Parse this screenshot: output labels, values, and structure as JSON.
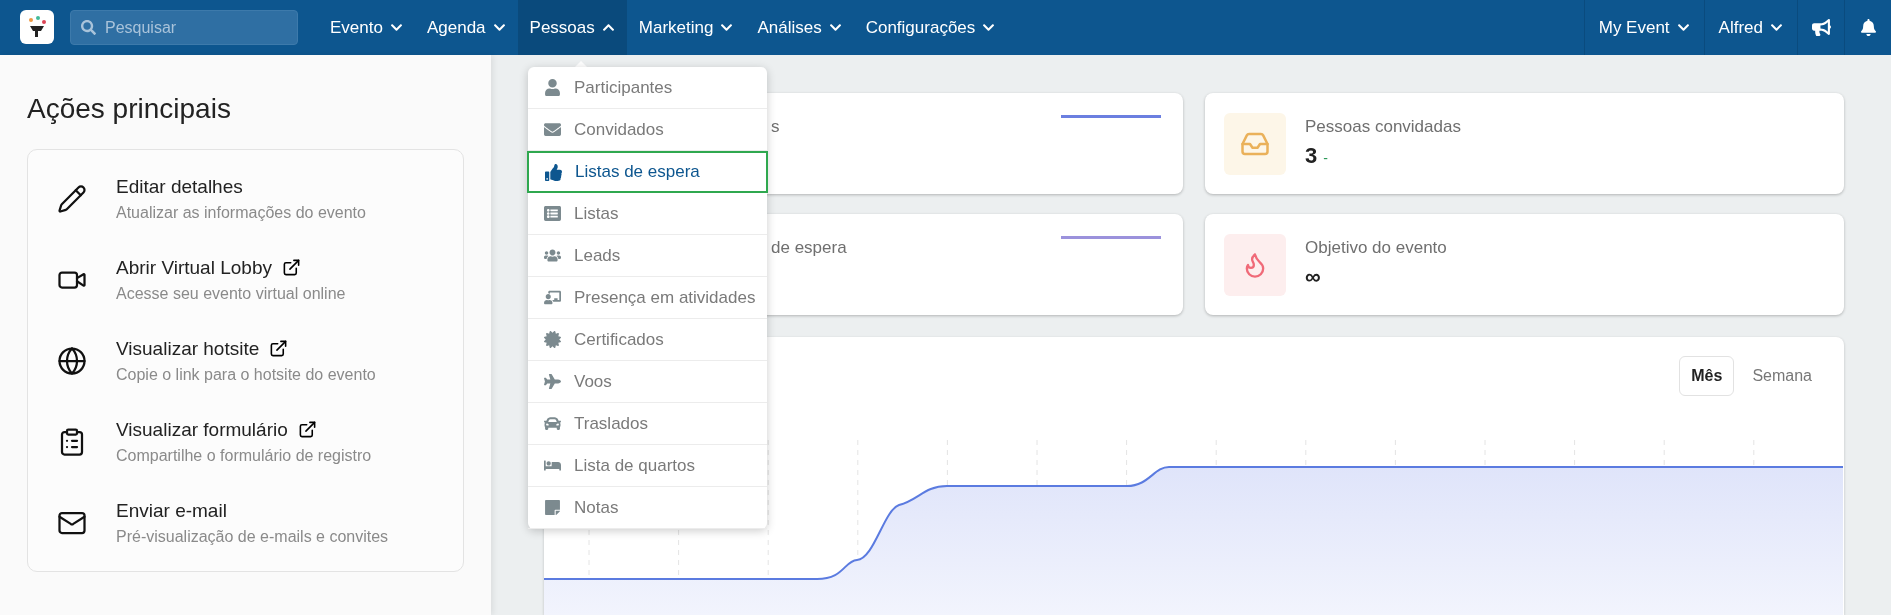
{
  "nav": {
    "search": {
      "placeholder": "Pesquisar"
    },
    "menus": [
      {
        "label": "Evento",
        "expanded": false
      },
      {
        "label": "Agenda",
        "expanded": false
      },
      {
        "label": "Pessoas",
        "expanded": true
      },
      {
        "label": "Marketing",
        "expanded": false
      },
      {
        "label": "Análises",
        "expanded": false
      },
      {
        "label": "Configurações",
        "expanded": false
      }
    ],
    "right_menus": [
      {
        "label": "My Event",
        "expanded": false
      },
      {
        "label": "Alfred",
        "expanded": false
      }
    ]
  },
  "sidebar": {
    "title": "Ações principais",
    "actions": [
      {
        "title": "Editar detalhes",
        "subtitle": "Atualizar as informações do evento",
        "external": false
      },
      {
        "title": "Abrir Virtual Lobby",
        "subtitle": "Acesse seu evento virtual online",
        "external": true
      },
      {
        "title": "Visualizar hotsite",
        "subtitle": "Copie o link para o hotsite do evento",
        "external": true
      },
      {
        "title": "Visualizar formulário",
        "subtitle": "Compartilhe o formulário de registro",
        "external": true
      },
      {
        "title": "Enviar e-mail",
        "subtitle": "Pré-visualização de e-mails e convites",
        "external": false
      }
    ]
  },
  "dropdown": [
    {
      "label": "Participantes",
      "selected": false
    },
    {
      "label": "Convidados",
      "selected": false
    },
    {
      "label": "Listas de espera",
      "selected": true
    },
    {
      "label": "Listas",
      "selected": false
    },
    {
      "label": "Leads",
      "selected": false
    },
    {
      "label": "Presença em atividades",
      "selected": false
    },
    {
      "label": "Certificados",
      "selected": false
    },
    {
      "label": "Voos",
      "selected": false
    },
    {
      "label": "Traslados",
      "selected": false
    },
    {
      "label": "Lista de quartos",
      "selected": false
    },
    {
      "label": "Notas",
      "selected": false
    }
  ],
  "stats": [
    {
      "kind": "covered",
      "title": "s",
      "color": "#6b7fe0"
    },
    {
      "kind": "icon",
      "title": "Pessoas convidadas",
      "value": "3",
      "delta": "-"
    },
    {
      "kind": "covered",
      "title": "de espera",
      "color": "#9b92dc"
    },
    {
      "kind": "icon",
      "title": "Objetivo do evento",
      "value": "∞"
    }
  ],
  "chart": {
    "toggles": [
      {
        "label": "Mês",
        "selected": true
      },
      {
        "label": "Semana",
        "selected": false
      }
    ]
  }
}
